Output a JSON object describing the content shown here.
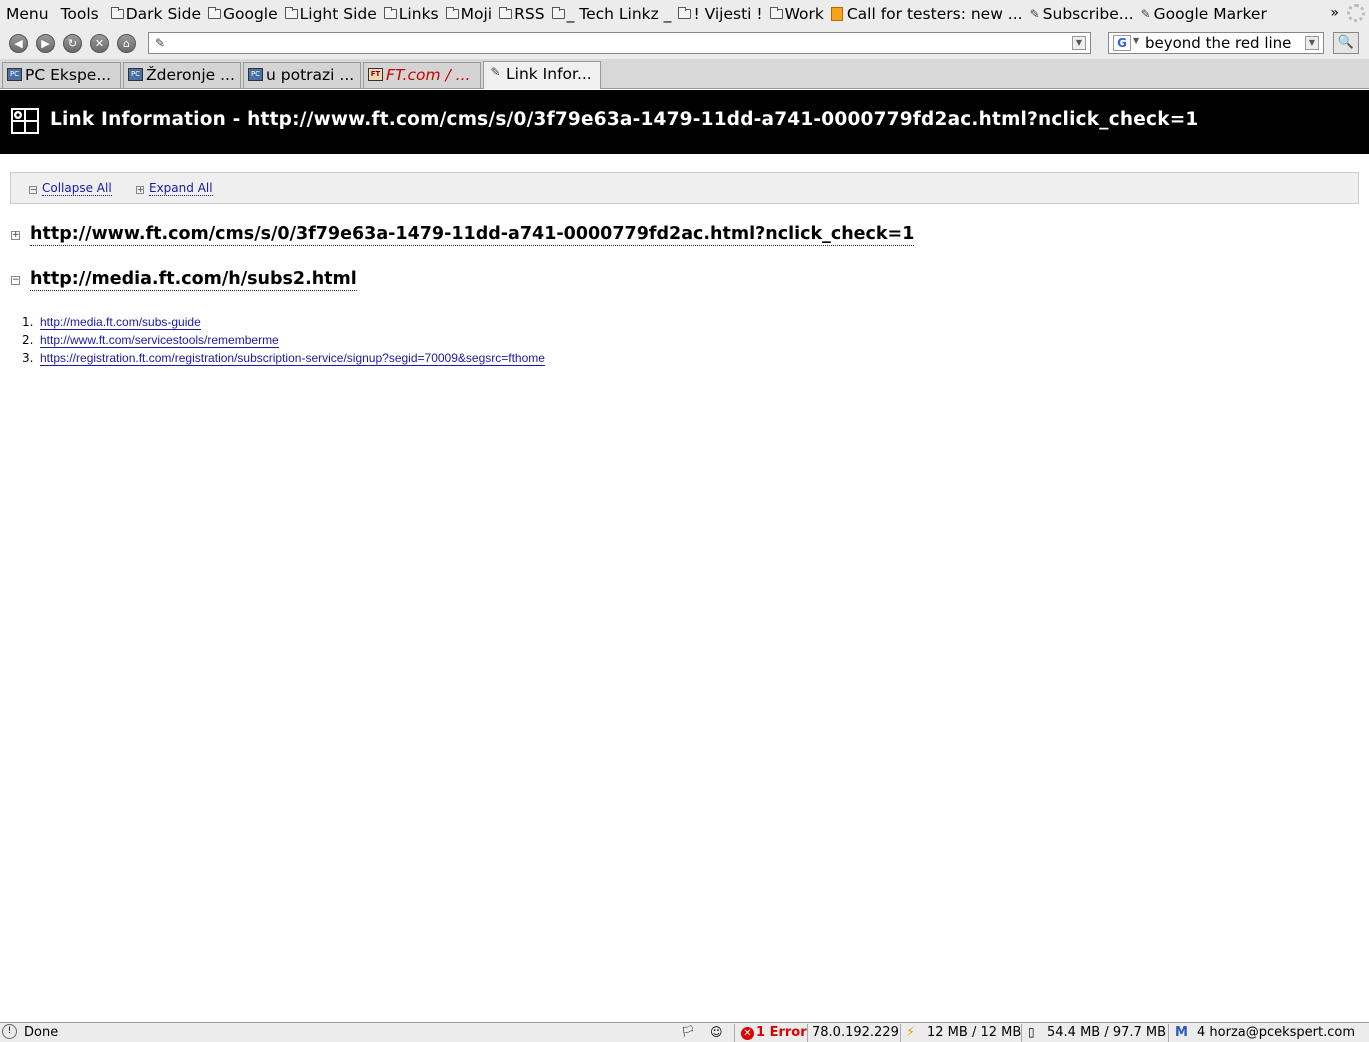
{
  "menubar": {
    "menu": "Menu",
    "tools": "Tools",
    "bookmarks": [
      {
        "label": "Dark Side",
        "icon": "folder-icon"
      },
      {
        "label": "Google",
        "icon": "folder-icon"
      },
      {
        "label": "Light Side",
        "icon": "folder-icon"
      },
      {
        "label": "Links",
        "icon": "folder-icon"
      },
      {
        "label": "Moji",
        "icon": "folder-icon"
      },
      {
        "label": "RSS",
        "icon": "folder-icon"
      },
      {
        "label": "_ Tech Linkz _",
        "icon": "folder-icon"
      },
      {
        "label": "! Vijesti !",
        "icon": "folder-icon"
      },
      {
        "label": "Work",
        "icon": "folder-icon"
      },
      {
        "label": "Call for testers: new ...",
        "icon": "feed-icon"
      },
      {
        "label": "Subscribe...",
        "icon": "clip-icon"
      },
      {
        "label": "Google Marker",
        "icon": "clip-icon"
      }
    ],
    "overflow": "»"
  },
  "navbar": {
    "url_value": "",
    "search_value": "beyond the red line",
    "search_engine": "G"
  },
  "tabs": [
    {
      "label": "PC Ekspe...",
      "icon": "site-icon"
    },
    {
      "label": "Žderonje ...",
      "icon": "site-icon"
    },
    {
      "label": "u potrazi ...",
      "icon": "site-icon"
    },
    {
      "label": "FT.com / ...",
      "icon": "ft-icon"
    },
    {
      "label": "Link Infor...",
      "icon": "clip-icon"
    }
  ],
  "page": {
    "title": "Link Information - http://www.ft.com/cms/s/0/3f79e63a-1479-11dd-a741-0000779fd2ac.html?nclick_check=1",
    "collapse_all": "Collapse All",
    "expand_all": "Expand All",
    "sections": [
      {
        "title": "http://www.ft.com/cms/s/0/3f79e63a-1479-11dd-a741-0000779fd2ac.html?nclick_check=1",
        "expanded": false,
        "toggle": "+"
      },
      {
        "title": "http://media.ft.com/h/subs2.html",
        "expanded": true,
        "toggle": "−"
      }
    ],
    "links": [
      {
        "num": "1.",
        "url": "http://media.ft.com/subs-guide"
      },
      {
        "num": "2.",
        "url": "http://www.ft.com/servicestools/rememberme"
      },
      {
        "num": "3.",
        "url": "https://registration.ft.com/registration/subscription-service/signup?segid=70009&segsrc=fthome"
      }
    ]
  },
  "statusbar": {
    "status": "Done",
    "error": "1 Error",
    "ip": "78.0.192.229",
    "memory": "12 MB / 12 MB",
    "cache": "54.4 MB / 97.7 MB",
    "mail": "4 horza@pcekspert.com"
  }
}
